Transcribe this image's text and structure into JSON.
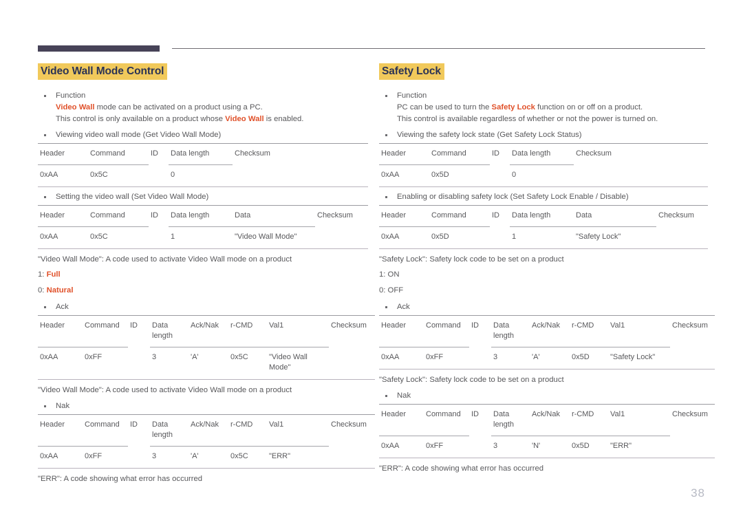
{
  "page": {
    "number": "38"
  },
  "left": {
    "title": "Video Wall Mode Control",
    "function_label": "Function",
    "function_line1_pre": "",
    "function_line1_em": "Video Wall",
    "function_line1_post": " mode can be activated on a product using a PC.",
    "function_line2_pre": "This control is only available on a product whose ",
    "function_line2_em": "Video Wall",
    "function_line2_post": " is enabled.",
    "get_bullet": "Viewing video wall mode (Get Video Wall Mode)",
    "get_table": {
      "headers": [
        "Header",
        "Command",
        "ID",
        "Data length",
        "Checksum"
      ],
      "row": [
        "0xAA",
        "0x5C",
        "",
        "0",
        ""
      ]
    },
    "set_bullet": "Setting the video wall (Set Video Wall Mode)",
    "set_table": {
      "headers": [
        "Header",
        "Command",
        "ID",
        "Data length",
        "Data",
        "Checksum"
      ],
      "row": [
        "0xAA",
        "0x5C",
        "",
        "1",
        "\"Video Wall Mode\"",
        ""
      ]
    },
    "caption_set": "\"Video Wall Mode\": A code used to activate Video Wall mode on a product",
    "value_1_key": "1: ",
    "value_1_val": "Full",
    "value_0_key": "0: ",
    "value_0_val": "Natural",
    "ack_bullet": "Ack",
    "ack_table": {
      "headers": [
        "Header",
        "Command",
        "ID",
        "Data length",
        "Ack/Nak",
        "r-CMD",
        "Val1",
        "Checksum"
      ],
      "row": [
        "0xAA",
        "0xFF",
        "",
        "3",
        "'A'",
        "0x5C",
        "\"Video Wall Mode\"",
        ""
      ]
    },
    "caption_ack": "\"Video Wall Mode\": A code used to activate Video Wall mode on a product",
    "nak_bullet": "Nak",
    "nak_table": {
      "headers": [
        "Header",
        "Command",
        "ID",
        "Data length",
        "Ack/Nak",
        "r-CMD",
        "Val1",
        "Checksum"
      ],
      "row": [
        "0xAA",
        "0xFF",
        "",
        "3",
        "'A'",
        "0x5C",
        "\"ERR\"",
        ""
      ]
    },
    "caption_nak": "\"ERR\": A code showing what error has occurred"
  },
  "right": {
    "title": "Safety Lock",
    "function_label": "Function",
    "function_line1_pre": "PC can be used to turn the ",
    "function_line1_em": "Safety Lock",
    "function_line1_post": " function on or off on a product.",
    "function_line2": "This control is available regardless of whether or not the power is turned on.",
    "get_bullet": "Viewing the safety lock state (Get Safety Lock Status)",
    "get_table": {
      "headers": [
        "Header",
        "Command",
        "ID",
        "Data length",
        "Checksum"
      ],
      "row": [
        "0xAA",
        "0x5D",
        "",
        "0",
        ""
      ]
    },
    "set_bullet": "Enabling or disabling safety lock (Set Safety Lock Enable / Disable)",
    "set_table": {
      "headers": [
        "Header",
        "Command",
        "ID",
        "Data length",
        "Data",
        "Checksum"
      ],
      "row": [
        "0xAA",
        "0x5D",
        "",
        "1",
        "\"Safety Lock\"",
        ""
      ]
    },
    "caption_set": "\"Safety Lock\": Safety lock code to be set on a product",
    "value_1": "1: ON",
    "value_0": "0: OFF",
    "ack_bullet": "Ack",
    "ack_table": {
      "headers": [
        "Header",
        "Command",
        "ID",
        "Data length",
        "Ack/Nak",
        "r-CMD",
        "Val1",
        "Checksum"
      ],
      "row": [
        "0xAA",
        "0xFF",
        "",
        "3",
        "'A'",
        "0x5D",
        "\"Safety Lock\"",
        ""
      ]
    },
    "caption_ack": "\"Safety Lock\": Safety lock code to be set on a product",
    "nak_bullet": "Nak",
    "nak_table": {
      "headers": [
        "Header",
        "Command",
        "ID",
        "Data length",
        "Ack/Nak",
        "r-CMD",
        "Val1",
        "Checksum"
      ],
      "row": [
        "0xAA",
        "0xFF",
        "",
        "3",
        "'N'",
        "0x5D",
        "\"ERR\"",
        ""
      ]
    },
    "caption_nak": "\"ERR\": A code showing what error has occurred"
  },
  "colors": {
    "accent_bar": "#474358",
    "title_highlight": "#f1c95b",
    "title_text": "#2b3355",
    "emphasis": "#e0512a",
    "body_text": "#58585b",
    "rule": "#b9b3bd",
    "page_number": "#b7bac4"
  }
}
